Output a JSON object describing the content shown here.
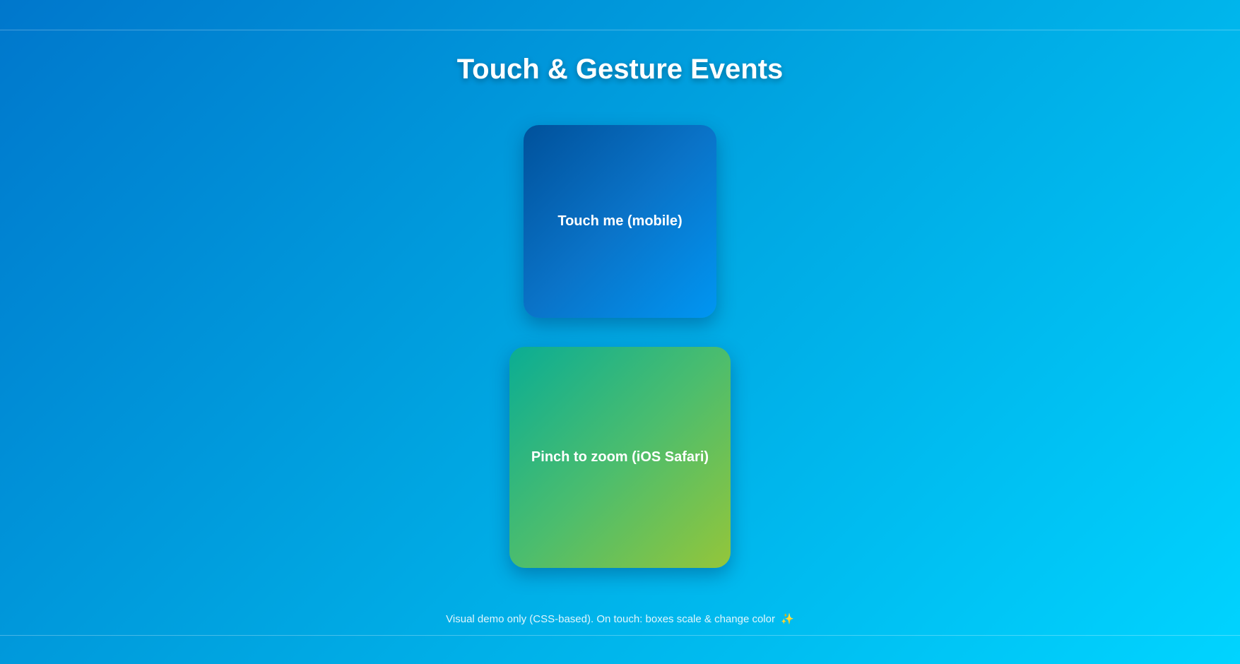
{
  "page": {
    "title": "Touch & Gesture Events"
  },
  "boxes": {
    "touch_label": "Touch me (mobile)",
    "pinch_label": "Pinch to zoom (iOS Safari)"
  },
  "footer": {
    "note": "Visual demo only (CSS-based). On touch: boxes scale & change color",
    "sparkle": "✨"
  },
  "colors": {
    "background_start": "#0077cc",
    "background_end": "#00d4ff",
    "touch_box_start": "#00519b",
    "touch_box_end": "#0096f2",
    "pinch_box_start": "#0aad94",
    "pinch_box_end": "#94c63a"
  },
  "icons": {
    "footer_icon": "sparkles-icon"
  }
}
